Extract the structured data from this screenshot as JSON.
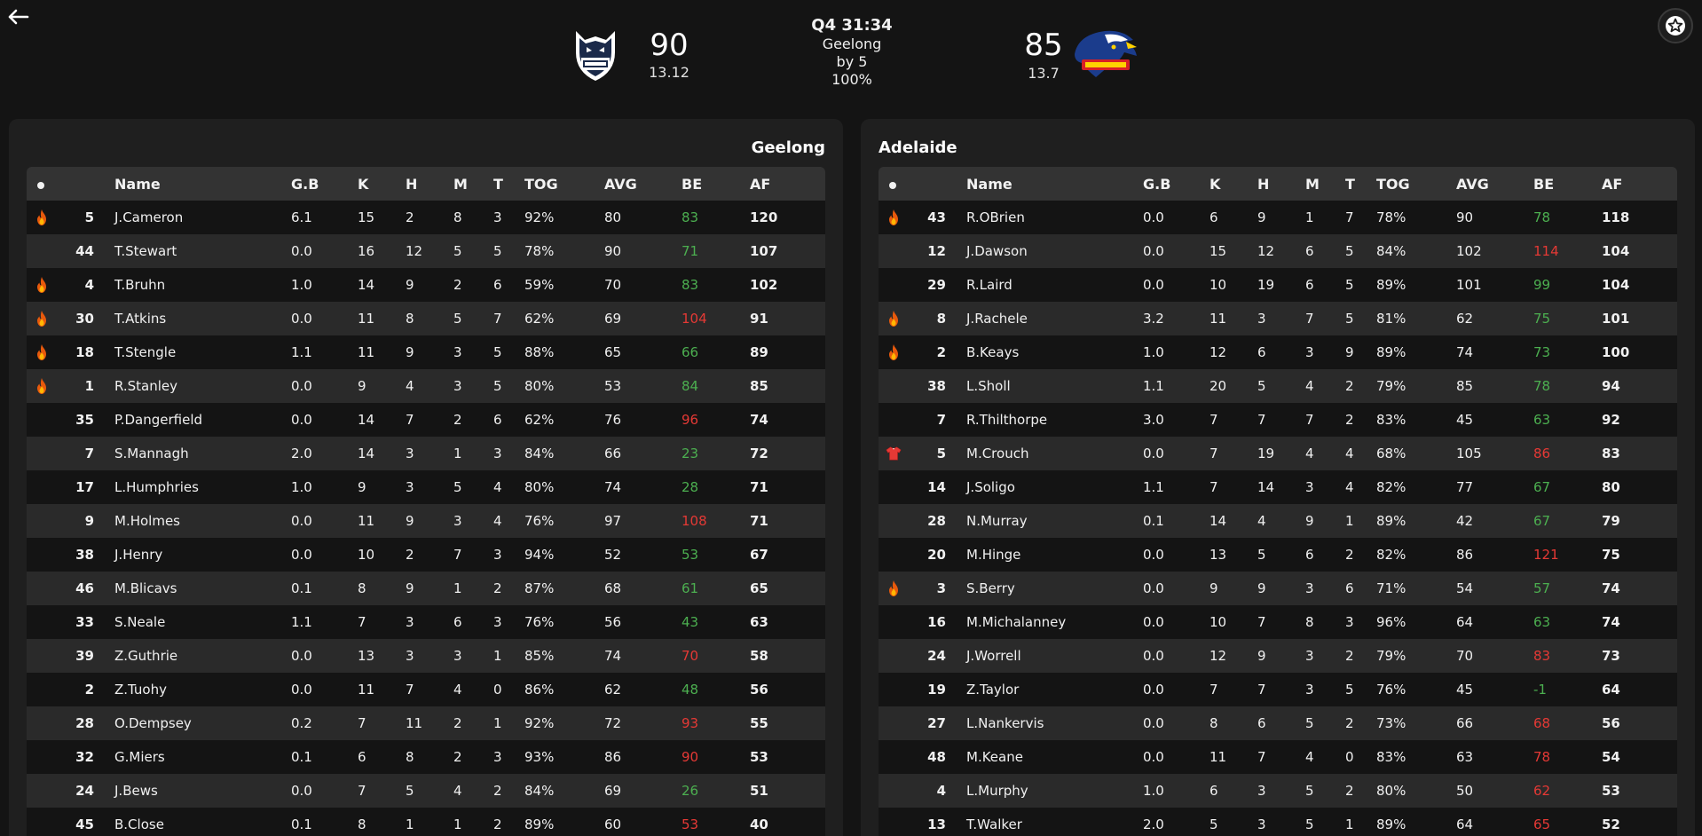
{
  "header": {
    "clock": "Q4 31:34",
    "leader": "Geelong",
    "margin": "by 5",
    "progress": "100%",
    "home": {
      "name": "Geelong",
      "score": "90",
      "goals_behinds": "13.12",
      "logo": "geelong-cats-logo"
    },
    "away": {
      "name": "Adelaide",
      "score": "85",
      "goals_behinds": "13.7",
      "logo": "adelaide-crows-logo"
    },
    "back_icon": "arrow-left-icon",
    "favourite_icon": "star-icon"
  },
  "columns": [
    "Name",
    "G.B",
    "K",
    "H",
    "M",
    "T",
    "TOG",
    "AVG",
    "BE",
    "AF"
  ],
  "colors": {
    "be_positive": "#4caf50",
    "be_negative": "#e53935",
    "background": "#141414",
    "panel": "#1f1f1f"
  },
  "home_team": {
    "title": "Geelong",
    "players": [
      {
        "icon": "fire",
        "num": "5",
        "name": "J.Cameron",
        "gb": "6.1",
        "k": "15",
        "h": "2",
        "m": "8",
        "t": "3",
        "tog": "92%",
        "avg": "80",
        "be": "83",
        "be_color": "green",
        "af": "120"
      },
      {
        "icon": "",
        "num": "44",
        "name": "T.Stewart",
        "gb": "0.0",
        "k": "16",
        "h": "12",
        "m": "5",
        "t": "5",
        "tog": "78%",
        "avg": "90",
        "be": "71",
        "be_color": "green",
        "af": "107"
      },
      {
        "icon": "fire",
        "num": "4",
        "name": "T.Bruhn",
        "gb": "1.0",
        "k": "14",
        "h": "9",
        "m": "2",
        "t": "6",
        "tog": "59%",
        "avg": "70",
        "be": "83",
        "be_color": "green",
        "af": "102"
      },
      {
        "icon": "fire",
        "num": "30",
        "name": "T.Atkins",
        "gb": "0.0",
        "k": "11",
        "h": "8",
        "m": "5",
        "t": "7",
        "tog": "62%",
        "avg": "69",
        "be": "104",
        "be_color": "red",
        "af": "91"
      },
      {
        "icon": "fire",
        "num": "18",
        "name": "T.Stengle",
        "gb": "1.1",
        "k": "11",
        "h": "9",
        "m": "3",
        "t": "5",
        "tog": "88%",
        "avg": "65",
        "be": "66",
        "be_color": "green",
        "af": "89"
      },
      {
        "icon": "fire",
        "num": "1",
        "name": "R.Stanley",
        "gb": "0.0",
        "k": "9",
        "h": "4",
        "m": "3",
        "t": "5",
        "tog": "80%",
        "avg": "53",
        "be": "84",
        "be_color": "green",
        "af": "85"
      },
      {
        "icon": "",
        "num": "35",
        "name": "P.Dangerfield",
        "gb": "0.0",
        "k": "14",
        "h": "7",
        "m": "2",
        "t": "6",
        "tog": "62%",
        "avg": "76",
        "be": "96",
        "be_color": "red",
        "af": "74"
      },
      {
        "icon": "",
        "num": "7",
        "name": "S.Mannagh",
        "gb": "2.0",
        "k": "14",
        "h": "3",
        "m": "1",
        "t": "3",
        "tog": "84%",
        "avg": "66",
        "be": "23",
        "be_color": "green",
        "af": "72"
      },
      {
        "icon": "",
        "num": "17",
        "name": "L.Humphries",
        "gb": "1.0",
        "k": "9",
        "h": "3",
        "m": "5",
        "t": "4",
        "tog": "80%",
        "avg": "74",
        "be": "28",
        "be_color": "green",
        "af": "71"
      },
      {
        "icon": "",
        "num": "9",
        "name": "M.Holmes",
        "gb": "0.0",
        "k": "11",
        "h": "9",
        "m": "3",
        "t": "4",
        "tog": "76%",
        "avg": "97",
        "be": "108",
        "be_color": "red",
        "af": "71"
      },
      {
        "icon": "",
        "num": "38",
        "name": "J.Henry",
        "gb": "0.0",
        "k": "10",
        "h": "2",
        "m": "7",
        "t": "3",
        "tog": "94%",
        "avg": "52",
        "be": "53",
        "be_color": "green",
        "af": "67"
      },
      {
        "icon": "",
        "num": "46",
        "name": "M.Blicavs",
        "gb": "0.1",
        "k": "8",
        "h": "9",
        "m": "1",
        "t": "2",
        "tog": "87%",
        "avg": "68",
        "be": "61",
        "be_color": "green",
        "af": "65"
      },
      {
        "icon": "",
        "num": "33",
        "name": "S.Neale",
        "gb": "1.1",
        "k": "7",
        "h": "3",
        "m": "6",
        "t": "3",
        "tog": "76%",
        "avg": "56",
        "be": "43",
        "be_color": "green",
        "af": "63"
      },
      {
        "icon": "",
        "num": "39",
        "name": "Z.Guthrie",
        "gb": "0.0",
        "k": "13",
        "h": "3",
        "m": "3",
        "t": "1",
        "tog": "85%",
        "avg": "74",
        "be": "70",
        "be_color": "red",
        "af": "58"
      },
      {
        "icon": "",
        "num": "2",
        "name": "Z.Tuohy",
        "gb": "0.0",
        "k": "11",
        "h": "7",
        "m": "4",
        "t": "0",
        "tog": "86%",
        "avg": "62",
        "be": "48",
        "be_color": "green",
        "af": "56"
      },
      {
        "icon": "",
        "num": "28",
        "name": "O.Dempsey",
        "gb": "0.2",
        "k": "7",
        "h": "11",
        "m": "2",
        "t": "1",
        "tog": "92%",
        "avg": "72",
        "be": "93",
        "be_color": "red",
        "af": "55"
      },
      {
        "icon": "",
        "num": "32",
        "name": "G.Miers",
        "gb": "0.1",
        "k": "6",
        "h": "8",
        "m": "2",
        "t": "3",
        "tog": "93%",
        "avg": "86",
        "be": "90",
        "be_color": "red",
        "af": "53"
      },
      {
        "icon": "",
        "num": "24",
        "name": "J.Bews",
        "gb": "0.0",
        "k": "7",
        "h": "5",
        "m": "4",
        "t": "2",
        "tog": "84%",
        "avg": "69",
        "be": "26",
        "be_color": "green",
        "af": "51"
      },
      {
        "icon": "",
        "num": "45",
        "name": "B.Close",
        "gb": "0.1",
        "k": "8",
        "h": "1",
        "m": "1",
        "t": "2",
        "tog": "89%",
        "avg": "60",
        "be": "53",
        "be_color": "red",
        "af": "40"
      }
    ]
  },
  "away_team": {
    "title": "Adelaide",
    "players": [
      {
        "icon": "fire",
        "num": "43",
        "name": "R.OBrien",
        "gb": "0.0",
        "k": "6",
        "h": "9",
        "m": "1",
        "t": "7",
        "tog": "78%",
        "avg": "90",
        "be": "78",
        "be_color": "green",
        "af": "118"
      },
      {
        "icon": "",
        "num": "12",
        "name": "J.Dawson",
        "gb": "0.0",
        "k": "15",
        "h": "12",
        "m": "6",
        "t": "5",
        "tog": "84%",
        "avg": "102",
        "be": "114",
        "be_color": "red",
        "af": "104"
      },
      {
        "icon": "",
        "num": "29",
        "name": "R.Laird",
        "gb": "0.0",
        "k": "10",
        "h": "19",
        "m": "6",
        "t": "5",
        "tog": "89%",
        "avg": "101",
        "be": "99",
        "be_color": "green",
        "af": "104"
      },
      {
        "icon": "fire",
        "num": "8",
        "name": "J.Rachele",
        "gb": "3.2",
        "k": "11",
        "h": "3",
        "m": "7",
        "t": "5",
        "tog": "81%",
        "avg": "62",
        "be": "75",
        "be_color": "green",
        "af": "101"
      },
      {
        "icon": "fire",
        "num": "2",
        "name": "B.Keays",
        "gb": "1.0",
        "k": "12",
        "h": "6",
        "m": "3",
        "t": "9",
        "tog": "89%",
        "avg": "74",
        "be": "73",
        "be_color": "green",
        "af": "100"
      },
      {
        "icon": "",
        "num": "38",
        "name": "L.Sholl",
        "gb": "1.1",
        "k": "20",
        "h": "5",
        "m": "4",
        "t": "2",
        "tog": "79%",
        "avg": "85",
        "be": "78",
        "be_color": "green",
        "af": "94"
      },
      {
        "icon": "",
        "num": "7",
        "name": "R.Thilthorpe",
        "gb": "3.0",
        "k": "7",
        "h": "7",
        "m": "7",
        "t": "2",
        "tog": "83%",
        "avg": "45",
        "be": "63",
        "be_color": "green",
        "af": "92"
      },
      {
        "icon": "shirt",
        "num": "5",
        "name": "M.Crouch",
        "gb": "0.0",
        "k": "7",
        "h": "19",
        "m": "4",
        "t": "4",
        "tog": "68%",
        "avg": "105",
        "be": "86",
        "be_color": "red",
        "af": "83"
      },
      {
        "icon": "",
        "num": "14",
        "name": "J.Soligo",
        "gb": "1.1",
        "k": "7",
        "h": "14",
        "m": "3",
        "t": "4",
        "tog": "82%",
        "avg": "77",
        "be": "67",
        "be_color": "green",
        "af": "80"
      },
      {
        "icon": "",
        "num": "28",
        "name": "N.Murray",
        "gb": "0.1",
        "k": "14",
        "h": "4",
        "m": "9",
        "t": "1",
        "tog": "89%",
        "avg": "42",
        "be": "67",
        "be_color": "green",
        "af": "79"
      },
      {
        "icon": "",
        "num": "20",
        "name": "M.Hinge",
        "gb": "0.0",
        "k": "13",
        "h": "5",
        "m": "6",
        "t": "2",
        "tog": "82%",
        "avg": "86",
        "be": "121",
        "be_color": "red",
        "af": "75"
      },
      {
        "icon": "fire",
        "num": "3",
        "name": "S.Berry",
        "gb": "0.0",
        "k": "9",
        "h": "9",
        "m": "3",
        "t": "6",
        "tog": "71%",
        "avg": "54",
        "be": "57",
        "be_color": "green",
        "af": "74"
      },
      {
        "icon": "",
        "num": "16",
        "name": "M.Michalanney",
        "gb": "0.0",
        "k": "10",
        "h": "7",
        "m": "8",
        "t": "3",
        "tog": "96%",
        "avg": "64",
        "be": "63",
        "be_color": "green",
        "af": "74"
      },
      {
        "icon": "",
        "num": "24",
        "name": "J.Worrell",
        "gb": "0.0",
        "k": "12",
        "h": "9",
        "m": "3",
        "t": "2",
        "tog": "79%",
        "avg": "70",
        "be": "83",
        "be_color": "red",
        "af": "73"
      },
      {
        "icon": "",
        "num": "19",
        "name": "Z.Taylor",
        "gb": "0.0",
        "k": "7",
        "h": "7",
        "m": "3",
        "t": "5",
        "tog": "76%",
        "avg": "45",
        "be": "-1",
        "be_color": "green",
        "af": "64"
      },
      {
        "icon": "",
        "num": "27",
        "name": "L.Nankervis",
        "gb": "0.0",
        "k": "8",
        "h": "6",
        "m": "5",
        "t": "2",
        "tog": "73%",
        "avg": "66",
        "be": "68",
        "be_color": "red",
        "af": "56"
      },
      {
        "icon": "",
        "num": "48",
        "name": "M.Keane",
        "gb": "0.0",
        "k": "11",
        "h": "7",
        "m": "4",
        "t": "0",
        "tog": "83%",
        "avg": "63",
        "be": "78",
        "be_color": "red",
        "af": "54"
      },
      {
        "icon": "",
        "num": "4",
        "name": "L.Murphy",
        "gb": "1.0",
        "k": "6",
        "h": "3",
        "m": "5",
        "t": "2",
        "tog": "80%",
        "avg": "50",
        "be": "62",
        "be_color": "red",
        "af": "53"
      },
      {
        "icon": "",
        "num": "13",
        "name": "T.Walker",
        "gb": "2.0",
        "k": "5",
        "h": "3",
        "m": "5",
        "t": "1",
        "tog": "89%",
        "avg": "64",
        "be": "65",
        "be_color": "red",
        "af": "52"
      }
    ]
  }
}
